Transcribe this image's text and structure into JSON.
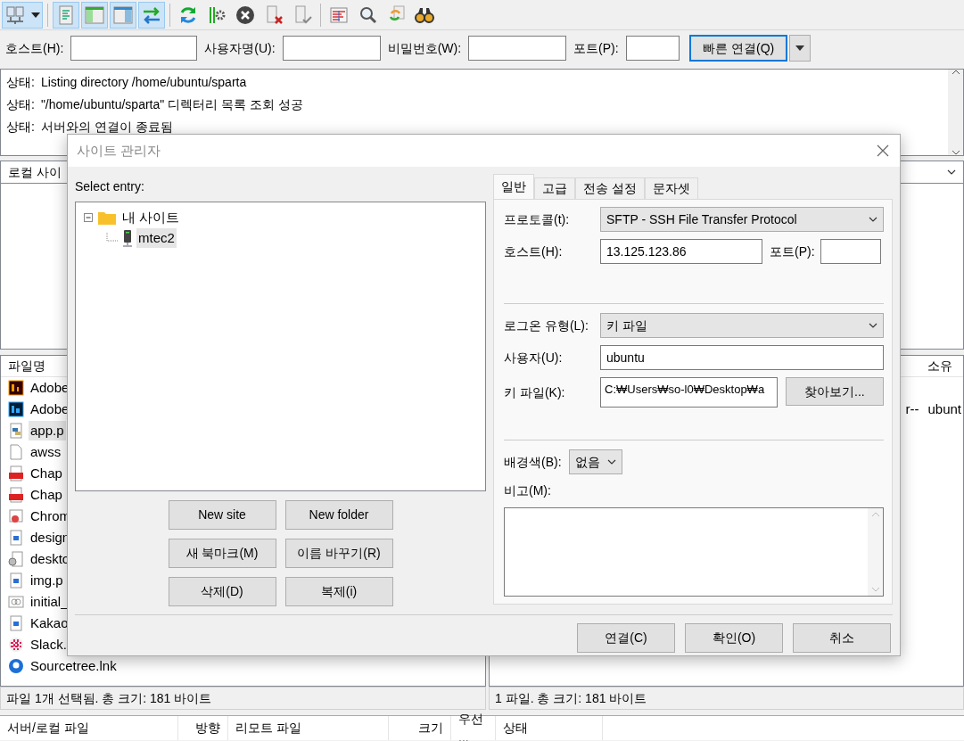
{
  "toolbar": {
    "buttons": [
      {
        "kind": "sitemanager",
        "on": true
      },
      {
        "kind": "log",
        "on": true
      },
      {
        "kind": "localtree",
        "on": true
      },
      {
        "kind": "remotetree",
        "on": true
      },
      {
        "kind": "transfer",
        "on": true
      },
      {
        "kind": "refresh",
        "on": false
      },
      {
        "kind": "process",
        "on": false
      },
      {
        "kind": "cancel",
        "on": false
      },
      {
        "kind": "disconnect",
        "on": false
      },
      {
        "kind": "reconnect",
        "on": false
      },
      {
        "kind": "filter",
        "on": false
      },
      {
        "kind": "search",
        "on": false
      },
      {
        "kind": "sync",
        "on": false
      },
      {
        "kind": "find",
        "on": false
      }
    ]
  },
  "quickconnect": {
    "fields": [
      {
        "label": "호스트(H):"
      },
      {
        "label": "사용자명(U):"
      },
      {
        "label": "비밀번호(W):"
      },
      {
        "label": "포트(P):"
      }
    ],
    "connect_button": "빠른 연결(Q)"
  },
  "log": {
    "lines": [
      {
        "prefix": "상태:",
        "text": "Listing directory /home/ubuntu/sparta"
      },
      {
        "prefix": "상태:",
        "text": "\"/home/ubuntu/sparta\" 디렉터리 목록 조회 성공"
      },
      {
        "prefix": "상태:",
        "text": "서버와의 연결이 종료됨"
      }
    ]
  },
  "local": {
    "site_label": "로컬 사이",
    "column": "파일명",
    "files": [
      {
        "name": "Adobe",
        "kind": "ai",
        "selected": false
      },
      {
        "name": "Adobe",
        "kind": "ps",
        "selected": false
      },
      {
        "name": "app.p",
        "kind": "python",
        "selected": true
      },
      {
        "name": "awss",
        "kind": "file",
        "selected": false
      },
      {
        "name": "Chap",
        "kind": "pdf",
        "selected": false
      },
      {
        "name": "Chap",
        "kind": "pdf",
        "selected": false
      },
      {
        "name": "Chrom",
        "kind": "shortcut",
        "selected": false
      },
      {
        "name": "design",
        "kind": "image",
        "selected": false
      },
      {
        "name": "deskto",
        "kind": "settings",
        "selected": false
      },
      {
        "name": "img.p",
        "kind": "image",
        "selected": false
      },
      {
        "name": "initial_",
        "kind": "link",
        "selected": false
      },
      {
        "name": "Kakao",
        "kind": "image",
        "selected": false
      },
      {
        "name": "Slack.",
        "kind": "slack",
        "selected": false
      },
      {
        "name": "Sourcetree.lnk",
        "kind": "sourcetree",
        "selected": false
      }
    ],
    "status": "파일 1개 선택됨. 총 크기: 181 바이트"
  },
  "remote": {
    "column": "소유",
    "row": {
      "permissions": "r--",
      "owner": "ubunt"
    },
    "status": "1 파일. 총 크기: 181 바이트"
  },
  "queue": {
    "columns": [
      "서버/로컬 파일",
      "방향",
      "리모트 파일",
      "크기",
      "우선 ...",
      "상태"
    ]
  },
  "dialog": {
    "title": "사이트 관리자",
    "select_label": "Select entry:",
    "tree": [
      {
        "label": "내 사이트",
        "kind": "folder",
        "expanded": true,
        "selected": false,
        "children": [
          {
            "label": "mtec2",
            "kind": "server",
            "selected": true
          }
        ]
      }
    ],
    "tree_buttons": [
      "New site",
      "New folder",
      "새 북마크(M)",
      "이름 바꾸기(R)",
      "삭제(D)",
      "복제(i)"
    ],
    "tabs": [
      {
        "label": "일반",
        "selected": true
      },
      {
        "label": "고급",
        "selected": false
      },
      {
        "label": "전송 설정",
        "selected": false
      },
      {
        "label": "문자셋",
        "selected": false
      }
    ],
    "protocol": {
      "label": "프로토콜(t):",
      "value": "SFTP - SSH File Transfer Protocol"
    },
    "host": {
      "label": "호스트(H):",
      "value": "13.125.123.86"
    },
    "port": {
      "label": "포트(P):"
    },
    "logon_type": {
      "label": "로그온 유형(L):",
      "value": "키 파일"
    },
    "user": {
      "label": "사용자(U):",
      "value": "ubuntu"
    },
    "key_file": {
      "label": "키 파일(K):",
      "value": "C:₩Users₩so-l0₩Desktop₩a",
      "browse": "찾아보기..."
    },
    "background": {
      "label": "배경색(B):",
      "value": "없음"
    },
    "comments": {
      "label": "비고(M):"
    },
    "buttons": [
      "연결(C)",
      "확인(O)",
      "취소"
    ]
  }
}
